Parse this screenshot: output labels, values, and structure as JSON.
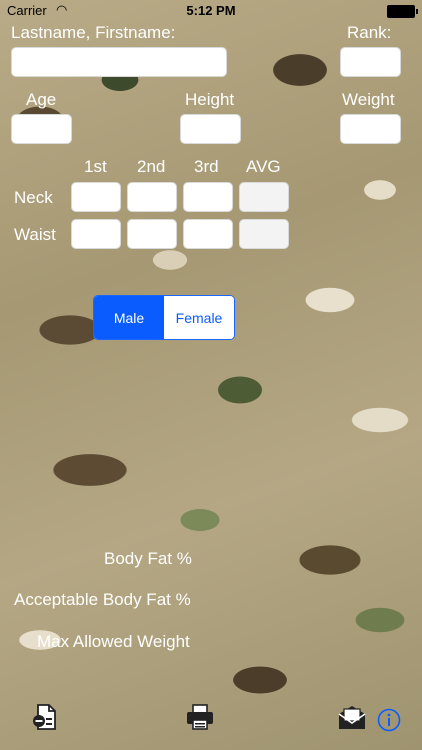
{
  "status_bar": {
    "carrier": "Carrier",
    "wifi_icon": "wifi-icon",
    "time": "5:12 PM",
    "battery_icon": "battery-icon"
  },
  "form": {
    "name_label": "Lastname, Firstname:",
    "rank_label": "Rank:",
    "age_label": "Age",
    "height_label": "Height",
    "weight_label": "Weight",
    "measure_headers": [
      "1st",
      "2nd",
      "3rd",
      "AVG"
    ],
    "neck_label": "Neck",
    "waist_label": "Waist"
  },
  "gender": {
    "male": "Male",
    "female": "Female",
    "selected": "Male"
  },
  "results": {
    "body_fat": "Body Fat %",
    "acceptable_body_fat": "Acceptable Body Fat %",
    "max_allowed_weight": "Max Allowed Weight"
  },
  "toolbar": {
    "icons": [
      "document-icon",
      "printer-icon",
      "mail-icon",
      "info-icon"
    ]
  },
  "colors": {
    "accent": "#0a5cff"
  }
}
